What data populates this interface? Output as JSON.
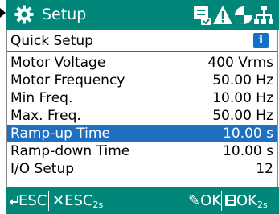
{
  "header": {
    "title": "Setup",
    "icons": [
      "gear-icon",
      "fieldbus-icon",
      "warning-icon",
      "motor-icon",
      "network-icon"
    ]
  },
  "menu": {
    "title": "Quick Setup",
    "info_icon": "i",
    "items": [
      {
        "label": "Motor Voltage",
        "value": "400 Vrms",
        "selected": false
      },
      {
        "label": "Motor Frequency",
        "value": "50.00 Hz",
        "selected": false
      },
      {
        "label": "Min Freq.",
        "value": "10.00 Hz",
        "selected": false
      },
      {
        "label": "Max. Freq.",
        "value": "50.00 Hz",
        "selected": false
      },
      {
        "label": "Ramp-up Time",
        "value": "10.00 s",
        "selected": true
      },
      {
        "label": "Ramp-down Time",
        "value": "10.00 s",
        "selected": false
      },
      {
        "label": "I/O Setup",
        "value": "12",
        "selected": false
      }
    ]
  },
  "footer": {
    "esc_back": "ESC",
    "esc_cancel": "ESC",
    "esc_cancel_sub": "2s",
    "ok_edit": "OK",
    "ok_save": "OK",
    "ok_save_sub": "2s"
  },
  "colors": {
    "header": "#00877a",
    "selection": "#1f70c1",
    "info": "#1570c8"
  }
}
